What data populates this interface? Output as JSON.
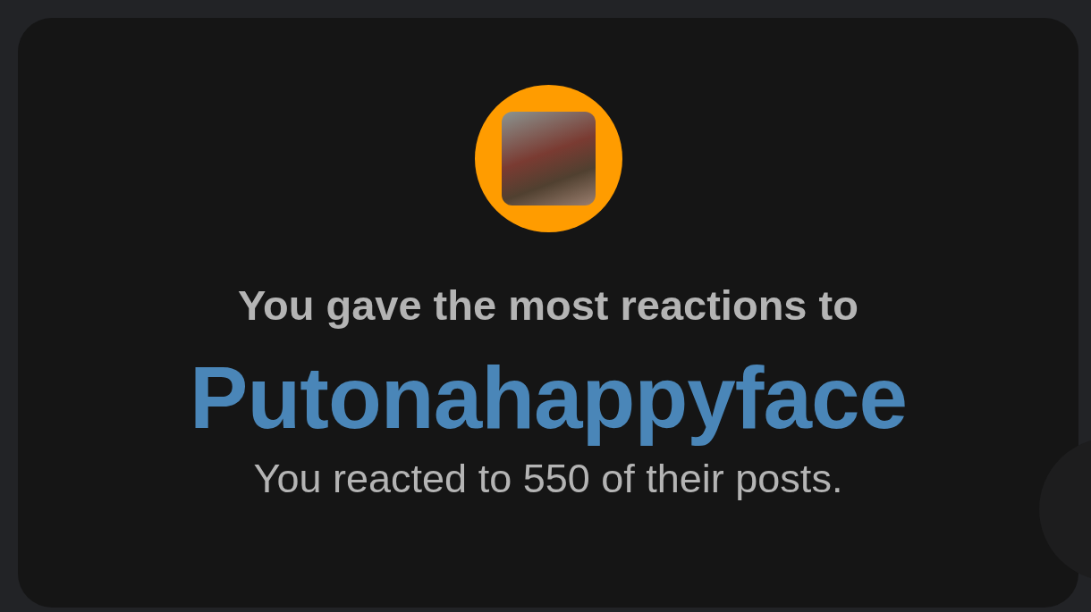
{
  "card": {
    "heading": "You gave the most reactions to",
    "name": "Putonahappyface",
    "detail": "You reacted to 550 of their posts."
  }
}
